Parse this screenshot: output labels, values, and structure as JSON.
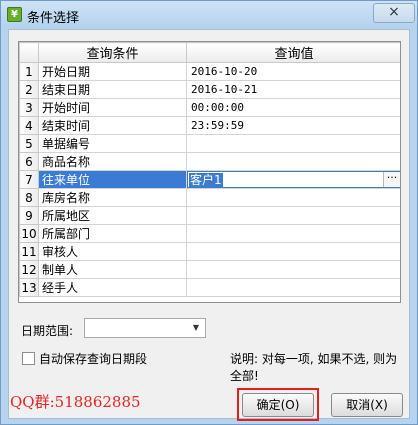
{
  "window": {
    "title": "条件选择",
    "app_icon": "¥",
    "close_label": "×"
  },
  "grid": {
    "headers": [
      "查询条件",
      "查询值"
    ],
    "rows": [
      {
        "num": "1",
        "cond": "开始日期",
        "val": "2016-10-20"
      },
      {
        "num": "2",
        "cond": "结束日期",
        "val": "2016-10-21"
      },
      {
        "num": "3",
        "cond": "开始时间",
        "val": "00:00:00"
      },
      {
        "num": "4",
        "cond": "结束时间",
        "val": "23:59:59"
      },
      {
        "num": "5",
        "cond": "单据编号",
        "val": ""
      },
      {
        "num": "6",
        "cond": "商品名称",
        "val": ""
      },
      {
        "num": "7",
        "cond": "往来单位",
        "val": "客户1"
      },
      {
        "num": "8",
        "cond": "库房名称",
        "val": ""
      },
      {
        "num": "9",
        "cond": "所属地区",
        "val": ""
      },
      {
        "num": "10",
        "cond": "所属部门",
        "val": ""
      },
      {
        "num": "11",
        "cond": "审核人",
        "val": ""
      },
      {
        "num": "12",
        "cond": "制单人",
        "val": ""
      },
      {
        "num": "13",
        "cond": "经手人",
        "val": ""
      }
    ],
    "selected_row": 6,
    "ellipsis": "···"
  },
  "filters": {
    "date_range_label": "日期范围:",
    "date_range_value": "",
    "dropdown_arrow": "▼",
    "autosave_label": "自动保存查询日期段",
    "autosave_checked": false,
    "note": "说明: 对每一项, 如果不选, 则为全部!"
  },
  "footer": {
    "qq_text": "QQ群:518862885",
    "ok_label": "确定(O)",
    "cancel_label": "取消(X)"
  }
}
